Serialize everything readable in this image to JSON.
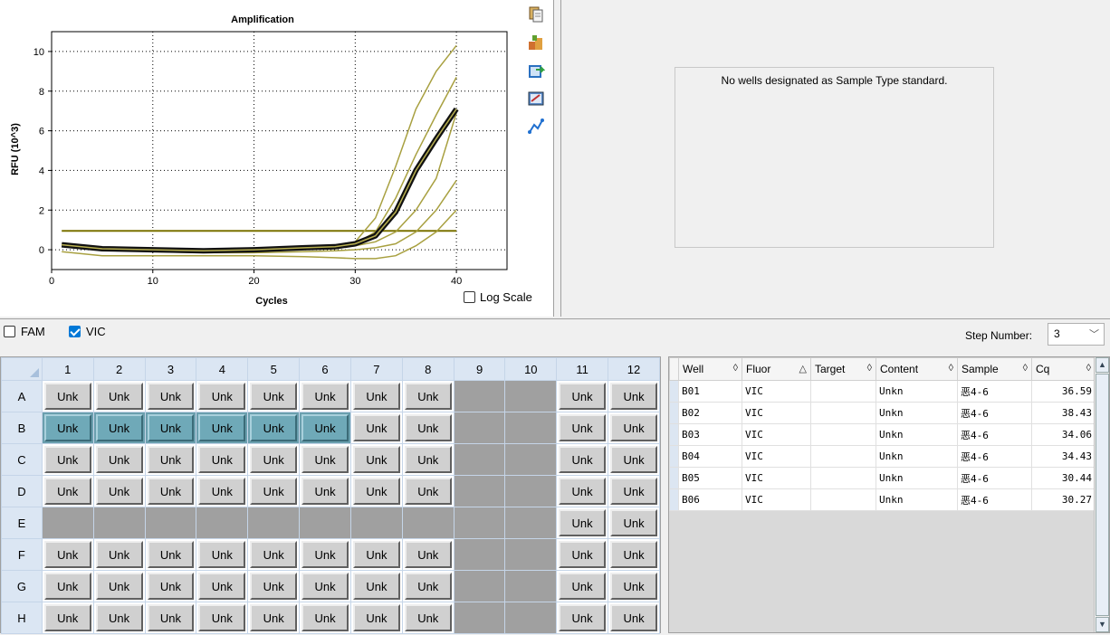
{
  "chart": {
    "title": "Amplification",
    "ylabel": "RFU (10^3)",
    "xlabel": "Cycles",
    "log_scale_label": "Log Scale",
    "log_scale_checked": false
  },
  "chart_data": {
    "type": "line",
    "title": "Amplification",
    "xlabel": "Cycles",
    "ylabel": "RFU (10^3)",
    "xlim": [
      0,
      45
    ],
    "ylim": [
      -1,
      11
    ],
    "xticks": [
      0,
      10,
      20,
      30,
      40
    ],
    "yticks": [
      0,
      2,
      4,
      6,
      8,
      10
    ],
    "grid": true,
    "threshold": 0.95,
    "series": [
      {
        "x": [
          1,
          5,
          10,
          15,
          20,
          25,
          28,
          30,
          32,
          34,
          36,
          38,
          40
        ],
        "y": [
          0.2,
          0.05,
          0.0,
          0.0,
          0.05,
          0.1,
          0.2,
          0.4,
          1.6,
          4.2,
          7.1,
          9.0,
          10.3
        ]
      },
      {
        "x": [
          1,
          5,
          10,
          15,
          20,
          25,
          28,
          30,
          32,
          34,
          36,
          38,
          40
        ],
        "y": [
          0.2,
          0.05,
          0.0,
          0.0,
          0.05,
          0.1,
          0.2,
          0.3,
          0.9,
          2.6,
          4.8,
          6.8,
          8.7
        ]
      },
      {
        "x": [
          1,
          5,
          10,
          15,
          20,
          25,
          28,
          30,
          32,
          34,
          36,
          38,
          40
        ],
        "y": [
          0.25,
          0.05,
          0.0,
          -0.05,
          0.0,
          0.1,
          0.15,
          0.3,
          0.7,
          1.9,
          4.0,
          5.6,
          7.1
        ]
      },
      {
        "x": [
          1,
          5,
          10,
          15,
          20,
          25,
          28,
          30,
          32,
          34,
          36,
          38,
          40
        ],
        "y": [
          0.3,
          0.05,
          -0.05,
          -0.05,
          0.0,
          0.05,
          0.1,
          0.2,
          0.4,
          0.9,
          2.0,
          3.6,
          6.9
        ]
      },
      {
        "x": [
          1,
          5,
          10,
          15,
          20,
          25,
          28,
          30,
          32,
          34,
          36,
          38,
          40
        ],
        "y": [
          0.3,
          0.1,
          -0.1,
          -0.15,
          -0.15,
          -0.1,
          -0.05,
          0.0,
          0.1,
          0.3,
          0.9,
          2.0,
          3.5
        ]
      },
      {
        "x": [
          1,
          5,
          10,
          15,
          20,
          25,
          28,
          30,
          32,
          34,
          36,
          38,
          40
        ],
        "y": [
          -0.1,
          -0.3,
          -0.3,
          -0.3,
          -0.3,
          -0.35,
          -0.4,
          -0.45,
          -0.45,
          -0.3,
          0.2,
          0.9,
          2.0
        ]
      }
    ],
    "highlighted_series": 2
  },
  "toolbar": {
    "icons": [
      "copy-icon",
      "export-icon",
      "save-image-icon",
      "chart-options-icon",
      "trace-icon"
    ]
  },
  "std_panel": {
    "message": "No wells designated as Sample Type standard."
  },
  "fluor": {
    "fam_label": "FAM",
    "fam_checked": false,
    "vic_label": "VIC",
    "vic_checked": true,
    "step_label": "Step Number:",
    "step_value": "3"
  },
  "plate": {
    "columns": [
      "1",
      "2",
      "3",
      "4",
      "5",
      "6",
      "7",
      "8",
      "9",
      "10",
      "11",
      "12"
    ],
    "rows": [
      {
        "label": "A",
        "wells": [
          "Unk",
          "Unk",
          "Unk",
          "Unk",
          "Unk",
          "Unk",
          "Unk",
          "Unk",
          "",
          "",
          "Unk",
          "Unk"
        ],
        "selected": []
      },
      {
        "label": "B",
        "wells": [
          "Unk",
          "Unk",
          "Unk",
          "Unk",
          "Unk",
          "Unk",
          "Unk",
          "Unk",
          "",
          "",
          "Unk",
          "Unk"
        ],
        "selected": [
          0,
          1,
          2,
          3,
          4,
          5
        ]
      },
      {
        "label": "C",
        "wells": [
          "Unk",
          "Unk",
          "Unk",
          "Unk",
          "Unk",
          "Unk",
          "Unk",
          "Unk",
          "",
          "",
          "Unk",
          "Unk"
        ],
        "selected": []
      },
      {
        "label": "D",
        "wells": [
          "Unk",
          "Unk",
          "Unk",
          "Unk",
          "Unk",
          "Unk",
          "Unk",
          "Unk",
          "",
          "",
          "Unk",
          "Unk"
        ],
        "selected": []
      },
      {
        "label": "E",
        "wells": [
          "",
          "",
          "",
          "",
          "",
          "",
          "",
          "",
          "",
          "",
          "Unk",
          "Unk"
        ],
        "selected": []
      },
      {
        "label": "F",
        "wells": [
          "Unk",
          "Unk",
          "Unk",
          "Unk",
          "Unk",
          "Unk",
          "Unk",
          "Unk",
          "",
          "",
          "Unk",
          "Unk"
        ],
        "selected": []
      },
      {
        "label": "G",
        "wells": [
          "Unk",
          "Unk",
          "Unk",
          "Unk",
          "Unk",
          "Unk",
          "Unk",
          "Unk",
          "",
          "",
          "Unk",
          "Unk"
        ],
        "selected": []
      },
      {
        "label": "H",
        "wells": [
          "Unk",
          "Unk",
          "Unk",
          "Unk",
          "Unk",
          "Unk",
          "Unk",
          "Unk",
          "",
          "",
          "Unk",
          "Unk"
        ],
        "selected": []
      }
    ]
  },
  "results": {
    "headers": [
      {
        "label": "Well",
        "sort": "◊"
      },
      {
        "label": "Fluor",
        "sort": "△"
      },
      {
        "label": "Target",
        "sort": "◊"
      },
      {
        "label": "Content",
        "sort": "◊"
      },
      {
        "label": "Sample",
        "sort": "◊"
      },
      {
        "label": "Cq",
        "sort": "◊"
      }
    ],
    "rows": [
      {
        "well": "B01",
        "fluor": "VIC",
        "target": "",
        "content": "Unkn",
        "sample": "恶4-6",
        "cq": "36.59"
      },
      {
        "well": "B02",
        "fluor": "VIC",
        "target": "",
        "content": "Unkn",
        "sample": "恶4-6",
        "cq": "38.43"
      },
      {
        "well": "B03",
        "fluor": "VIC",
        "target": "",
        "content": "Unkn",
        "sample": "恶4-6",
        "cq": "34.06"
      },
      {
        "well": "B04",
        "fluor": "VIC",
        "target": "",
        "content": "Unkn",
        "sample": "恶4-6",
        "cq": "34.43"
      },
      {
        "well": "B05",
        "fluor": "VIC",
        "target": "",
        "content": "Unkn",
        "sample": "恶4-6",
        "cq": "30.44"
      },
      {
        "well": "B06",
        "fluor": "VIC",
        "target": "",
        "content": "Unkn",
        "sample": "恶4-6",
        "cq": "30.27"
      }
    ]
  },
  "colors": {
    "curve": "#a8a040",
    "highlight_outer": "#111111",
    "highlight_inner": "#b8b050",
    "threshold": "#7a7200",
    "selected_well": "#6fa9b8",
    "empty_well": "#a0a0a0"
  }
}
